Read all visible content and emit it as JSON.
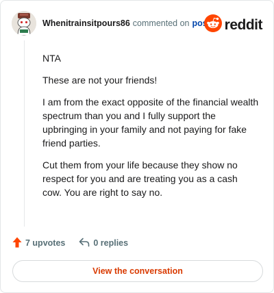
{
  "comment": {
    "avatar_icon": "snoo-avatar-icon",
    "username": "Whenitrainsitpours86",
    "action_text": "commented on",
    "post_link": "post",
    "paragraphs": [
      "NTA",
      "These are not your friends!",
      "I am from the exact opposite of the financial wealth spectrum than you and I fully support the upbringing in your family and not paying for fake friend parties.",
      "Cut them from your life because they show no respect for you and are treating you as a cash cow. You are right to say no."
    ]
  },
  "brand": {
    "icon": "reddit-snoo-icon",
    "wordmark": "reddit",
    "accent_color": "#ff4500"
  },
  "actions": {
    "upvotes_icon": "upvote-arrow-icon",
    "upvotes": "7 upvotes",
    "replies_icon": "reply-arrow-icon",
    "replies": "0 replies"
  },
  "cta": {
    "label": "View the conversation",
    "color": "#d93a00"
  }
}
